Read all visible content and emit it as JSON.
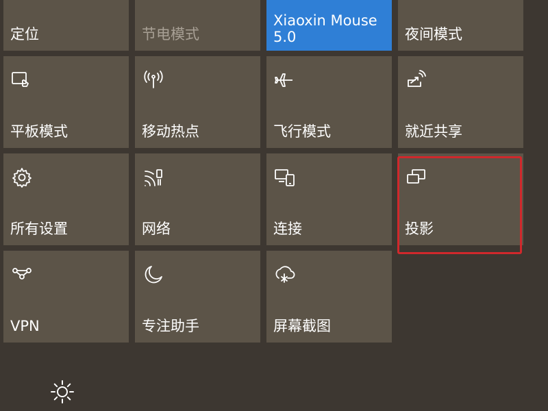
{
  "action_center": {
    "tiles": [
      {
        "label": "定位",
        "icon": "location-icon",
        "state": "on"
      },
      {
        "label": "节电模式",
        "icon": "battery-saver-icon",
        "state": "disabled"
      },
      {
        "label": "Xiaoxin Mouse 5.0",
        "icon": "bluetooth-icon",
        "state": "active"
      },
      {
        "label": "夜间模式",
        "icon": "night-light-icon",
        "state": "off"
      },
      {
        "label": "平板模式",
        "icon": "tablet-mode-icon",
        "state": "off"
      },
      {
        "label": "移动热点",
        "icon": "mobile-hotspot-icon",
        "state": "off"
      },
      {
        "label": "飞行模式",
        "icon": "airplane-icon",
        "state": "off"
      },
      {
        "label": "就近共享",
        "icon": "nearby-share-icon",
        "state": "off"
      },
      {
        "label": "所有设置",
        "icon": "settings-gear-icon",
        "state": "off"
      },
      {
        "label": "网络",
        "icon": "network-icon",
        "state": "off"
      },
      {
        "label": "连接",
        "icon": "connect-icon",
        "state": "off"
      },
      {
        "label": "投影",
        "icon": "project-icon",
        "state": "highlighted"
      },
      {
        "label": "VPN",
        "icon": "vpn-icon",
        "state": "off"
      },
      {
        "label": "专注助手",
        "icon": "focus-assist-moon-icon",
        "state": "off"
      },
      {
        "label": "屏幕截图",
        "icon": "screen-snip-icon",
        "state": "off"
      }
    ],
    "brightness_icon": "brightness-sun-icon"
  },
  "colors": {
    "background": "#3d3731",
    "tile": "#5c5448",
    "accent": "#2f7fd6",
    "highlight_border": "#d0282c",
    "disabled_text": "#a8a095"
  }
}
